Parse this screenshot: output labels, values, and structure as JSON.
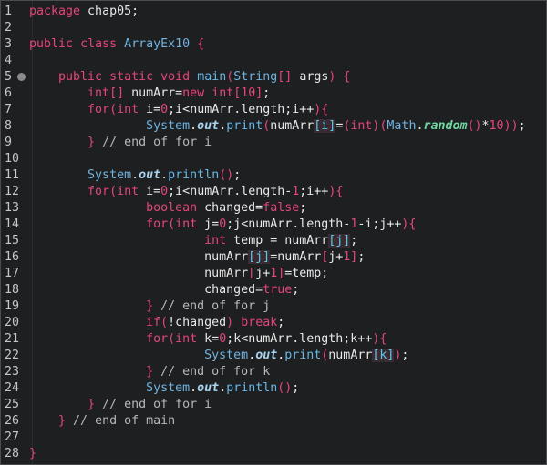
{
  "editor": {
    "lines": [
      {
        "n": "1",
        "segs": [
          [
            "kw",
            "package"
          ],
          [
            "op",
            " chap05;"
          ]
        ]
      },
      {
        "n": "2",
        "segs": []
      },
      {
        "n": "3",
        "segs": [
          [
            "kw",
            "public"
          ],
          [
            "op",
            " "
          ],
          [
            "kw",
            "class"
          ],
          [
            "op",
            " "
          ],
          [
            "cls",
            "ArrayEx10"
          ],
          [
            "op",
            " "
          ],
          [
            "br",
            "{"
          ]
        ]
      },
      {
        "n": "4",
        "segs": []
      },
      {
        "n": "5",
        "fold": true,
        "segs": [
          [
            "op",
            "    "
          ],
          [
            "kw",
            "public"
          ],
          [
            "op",
            " "
          ],
          [
            "kw",
            "static"
          ],
          [
            "op",
            " "
          ],
          [
            "kw",
            "void"
          ],
          [
            "op",
            " "
          ],
          [
            "fn",
            "main"
          ],
          [
            "br",
            "("
          ],
          [
            "cls",
            "String"
          ],
          [
            "br",
            "[]"
          ],
          [
            "op",
            " args"
          ],
          [
            "br",
            ")"
          ],
          [
            "op",
            " "
          ],
          [
            "br",
            "{"
          ]
        ]
      },
      {
        "n": "6",
        "segs": [
          [
            "op",
            "        "
          ],
          [
            "kw",
            "int"
          ],
          [
            "br",
            "[]"
          ],
          [
            "op",
            " numArr="
          ],
          [
            "kw",
            "new"
          ],
          [
            "op",
            " "
          ],
          [
            "kw",
            "int"
          ],
          [
            "br",
            "["
          ],
          [
            "num",
            "10"
          ],
          [
            "br",
            "]"
          ],
          [
            "op",
            ";"
          ]
        ]
      },
      {
        "n": "7",
        "segs": [
          [
            "op",
            "        "
          ],
          [
            "kw",
            "for"
          ],
          [
            "br",
            "("
          ],
          [
            "kw",
            "int"
          ],
          [
            "op",
            " i="
          ],
          [
            "num",
            "0"
          ],
          [
            "op",
            ";i<numArr.length;i++"
          ],
          [
            "br",
            ")"
          ],
          [
            "br",
            "{"
          ]
        ]
      },
      {
        "n": "8",
        "segs": [
          [
            "op",
            "                "
          ],
          [
            "cls",
            "System"
          ],
          [
            "op",
            "."
          ],
          [
            "static-f",
            "out"
          ],
          [
            "op",
            "."
          ],
          [
            "fn",
            "print"
          ],
          [
            "br",
            "("
          ],
          [
            "op",
            "numArr"
          ],
          [
            "idx",
            "[i]"
          ],
          [
            "op",
            "="
          ],
          [
            "br",
            "("
          ],
          [
            "kw",
            "int"
          ],
          [
            "br",
            ")"
          ],
          [
            "br",
            "("
          ],
          [
            "cls",
            "Math"
          ],
          [
            "op",
            "."
          ],
          [
            "ital",
            "random"
          ],
          [
            "br",
            "()"
          ],
          [
            "op",
            "*"
          ],
          [
            "num",
            "10"
          ],
          [
            "br",
            "))"
          ],
          [
            "op",
            ";"
          ]
        ]
      },
      {
        "n": "9",
        "segs": [
          [
            "op",
            "        "
          ],
          [
            "br",
            "}"
          ],
          [
            "cm",
            " // end of for i"
          ]
        ]
      },
      {
        "n": "10",
        "segs": []
      },
      {
        "n": "11",
        "segs": [
          [
            "op",
            "        "
          ],
          [
            "cls",
            "System"
          ],
          [
            "op",
            "."
          ],
          [
            "static-f",
            "out"
          ],
          [
            "op",
            "."
          ],
          [
            "fn",
            "println"
          ],
          [
            "br",
            "()"
          ],
          [
            "op",
            ";"
          ]
        ]
      },
      {
        "n": "12",
        "segs": [
          [
            "op",
            "        "
          ],
          [
            "kw",
            "for"
          ],
          [
            "br",
            "("
          ],
          [
            "kw",
            "int"
          ],
          [
            "op",
            " i="
          ],
          [
            "num",
            "0"
          ],
          [
            "op",
            ";i<numArr.length-"
          ],
          [
            "num",
            "1"
          ],
          [
            "op",
            ";i++"
          ],
          [
            "br",
            ")"
          ],
          [
            "br",
            "{"
          ]
        ]
      },
      {
        "n": "13",
        "segs": [
          [
            "op",
            "                "
          ],
          [
            "kw",
            "boolean"
          ],
          [
            "op",
            " changed="
          ],
          [
            "kw",
            "false"
          ],
          [
            "op",
            ";"
          ]
        ]
      },
      {
        "n": "14",
        "segs": [
          [
            "op",
            "                "
          ],
          [
            "kw",
            "for"
          ],
          [
            "br",
            "("
          ],
          [
            "kw",
            "int"
          ],
          [
            "op",
            " j="
          ],
          [
            "num",
            "0"
          ],
          [
            "op",
            ";j<numArr.length-"
          ],
          [
            "num",
            "1"
          ],
          [
            "op",
            "-i;j++"
          ],
          [
            "br",
            ")"
          ],
          [
            "br",
            "{"
          ]
        ]
      },
      {
        "n": "15",
        "segs": [
          [
            "op",
            "                        "
          ],
          [
            "kw",
            "int"
          ],
          [
            "op",
            " temp = numArr"
          ],
          [
            "idx",
            "[j]"
          ],
          [
            "op",
            ";"
          ]
        ]
      },
      {
        "n": "16",
        "segs": [
          [
            "op",
            "                        numArr"
          ],
          [
            "idx",
            "[j]"
          ],
          [
            "op",
            "=numArr"
          ],
          [
            "br",
            "["
          ],
          [
            "op",
            "j+"
          ],
          [
            "num",
            "1"
          ],
          [
            "br",
            "]"
          ],
          [
            "op",
            ";"
          ]
        ]
      },
      {
        "n": "17",
        "segs": [
          [
            "op",
            "                        numArr"
          ],
          [
            "br",
            "["
          ],
          [
            "op",
            "j+"
          ],
          [
            "num",
            "1"
          ],
          [
            "br",
            "]"
          ],
          [
            "op",
            "=temp;"
          ]
        ]
      },
      {
        "n": "18",
        "segs": [
          [
            "op",
            "                        changed="
          ],
          [
            "kw",
            "true"
          ],
          [
            "op",
            ";"
          ]
        ]
      },
      {
        "n": "19",
        "segs": [
          [
            "op",
            "                "
          ],
          [
            "br",
            "}"
          ],
          [
            "cm",
            " // end of for j"
          ]
        ]
      },
      {
        "n": "20",
        "segs": [
          [
            "op",
            "                "
          ],
          [
            "kw",
            "if"
          ],
          [
            "br",
            "("
          ],
          [
            "op",
            "!changed"
          ],
          [
            "br",
            ")"
          ],
          [
            "op",
            " "
          ],
          [
            "kw",
            "break"
          ],
          [
            "op",
            ";"
          ]
        ]
      },
      {
        "n": "21",
        "segs": [
          [
            "op",
            "                "
          ],
          [
            "kw",
            "for"
          ],
          [
            "br",
            "("
          ],
          [
            "kw",
            "int"
          ],
          [
            "op",
            " k="
          ],
          [
            "num",
            "0"
          ],
          [
            "op",
            ";k<numArr.length;k++"
          ],
          [
            "br",
            ")"
          ],
          [
            "br",
            "{"
          ]
        ]
      },
      {
        "n": "22",
        "segs": [
          [
            "op",
            "                        "
          ],
          [
            "cls",
            "System"
          ],
          [
            "op",
            "."
          ],
          [
            "static-f",
            "out"
          ],
          [
            "op",
            "."
          ],
          [
            "fn",
            "print"
          ],
          [
            "br",
            "("
          ],
          [
            "op",
            "numArr"
          ],
          [
            "idx",
            "[k]"
          ],
          [
            "br",
            ")"
          ],
          [
            "op",
            ";"
          ]
        ]
      },
      {
        "n": "23",
        "segs": [
          [
            "op",
            "                "
          ],
          [
            "br",
            "}"
          ],
          [
            "cm",
            " // end of for k"
          ]
        ]
      },
      {
        "n": "24",
        "segs": [
          [
            "op",
            "                "
          ],
          [
            "cls",
            "System"
          ],
          [
            "op",
            "."
          ],
          [
            "static-f",
            "out"
          ],
          [
            "op",
            "."
          ],
          [
            "fn",
            "println"
          ],
          [
            "br",
            "()"
          ],
          [
            "op",
            ";"
          ]
        ]
      },
      {
        "n": "25",
        "segs": [
          [
            "op",
            "        "
          ],
          [
            "br",
            "}"
          ],
          [
            "cm",
            " // end of for i"
          ]
        ]
      },
      {
        "n": "26",
        "segs": [
          [
            "op",
            "    "
          ],
          [
            "br",
            "}"
          ],
          [
            "cm",
            " // end of main"
          ]
        ]
      },
      {
        "n": "27",
        "segs": []
      },
      {
        "n": "28",
        "segs": [
          [
            "br",
            "}"
          ]
        ]
      }
    ]
  }
}
